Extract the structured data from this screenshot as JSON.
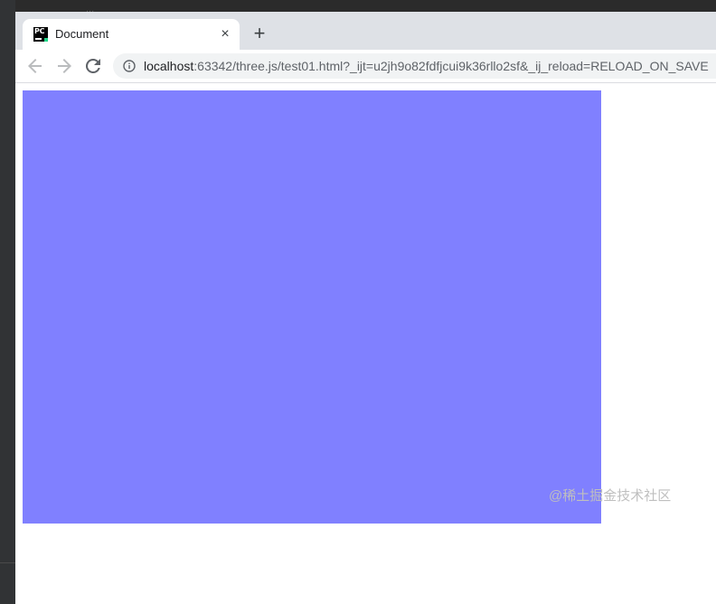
{
  "background": {
    "editor_snippet": "..."
  },
  "tab": {
    "title": "Document",
    "favicon_text": "PC",
    "close_glyph": "×"
  },
  "new_tab_glyph": "+",
  "address_bar": {
    "host": "localhost",
    "path": ":63342/three.js/test01.html?_ijt=u2jh9o82fdfjcui9k36rllo2sf&_ij_reload=RELOAD_ON_SAVE"
  },
  "icons": {
    "back": "arrow-left-icon",
    "forward": "arrow-right-icon",
    "reload": "reload-icon",
    "info": "info-icon"
  },
  "content": {
    "canvas_color": "#8080ff"
  },
  "watermark": "@稀土掘金技术社区"
}
